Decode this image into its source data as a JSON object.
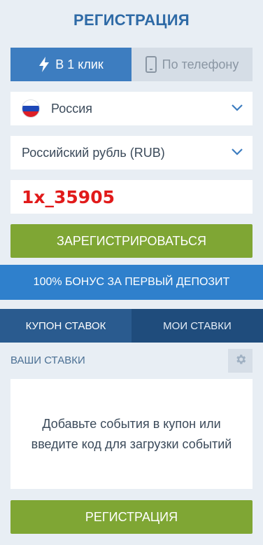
{
  "header": {
    "title": "РЕГИСТРАЦИЯ"
  },
  "reg_tabs": [
    {
      "label": "В 1 клик",
      "icon": "lightning-icon",
      "active": true
    },
    {
      "label": "По телефону",
      "icon": "phone-icon",
      "active": false
    }
  ],
  "country": {
    "value": "Россия",
    "flag": "russia-flag-icon"
  },
  "currency": {
    "value": "Российский рубль (RUB)"
  },
  "promo_code": {
    "value": "1x_35905",
    "color": "#e11a1a"
  },
  "register_button": {
    "label": "ЗАРЕГИСТРИРОВАТЬСЯ"
  },
  "bonus_banner": {
    "label": "100% БОНУС ЗА ПЕРВЫЙ ДЕПОЗИТ"
  },
  "coupon_tabs": [
    {
      "label": "КУПОН СТАВОК",
      "active": true
    },
    {
      "label": "МОИ СТАВКИ",
      "active": false
    }
  ],
  "bets": {
    "label": "ВАШИ СТАВКИ",
    "settings_icon": "gear-icon",
    "empty_text": "Добавьте события в купон или введите код для загрузки событий"
  },
  "bottom_button": {
    "label": "РЕГИСТРАЦИЯ"
  },
  "colors": {
    "accent_blue": "#3d7dc0",
    "banner_blue": "#2f80cc",
    "dark_blue": "#1f4c7c",
    "green": "#7fa634",
    "background": "#e8eef4"
  }
}
